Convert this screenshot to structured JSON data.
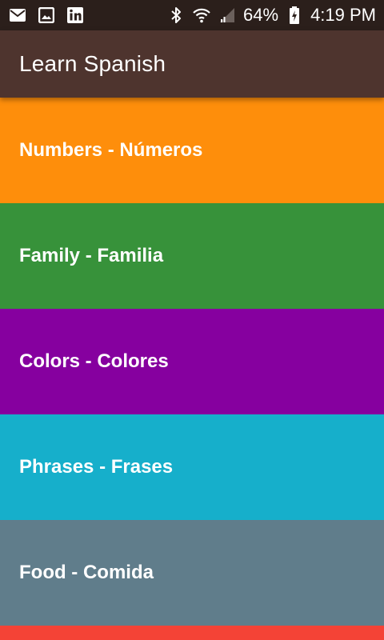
{
  "status_bar": {
    "battery_text": "64%",
    "time": "4:19 PM",
    "left_icons": [
      "mail-icon",
      "image-icon",
      "linkedin-icon"
    ],
    "right_icons": [
      "bluetooth-icon",
      "wifi-icon",
      "signal-icon",
      "battery-charging-icon"
    ]
  },
  "app_bar": {
    "title": "Learn Spanish",
    "color": "#4e342e"
  },
  "categories": [
    {
      "label": "Numbers - Números",
      "color": "#fe8e0b"
    },
    {
      "label": "Family - Familia",
      "color": "#37923a"
    },
    {
      "label": "Colors - Colores",
      "color": "#86009f"
    },
    {
      "label": "Phrases - Frases",
      "color": "#16afcb"
    },
    {
      "label": "Food - Comida",
      "color": "#607d8b"
    }
  ],
  "partial_item_color": "#f44336"
}
